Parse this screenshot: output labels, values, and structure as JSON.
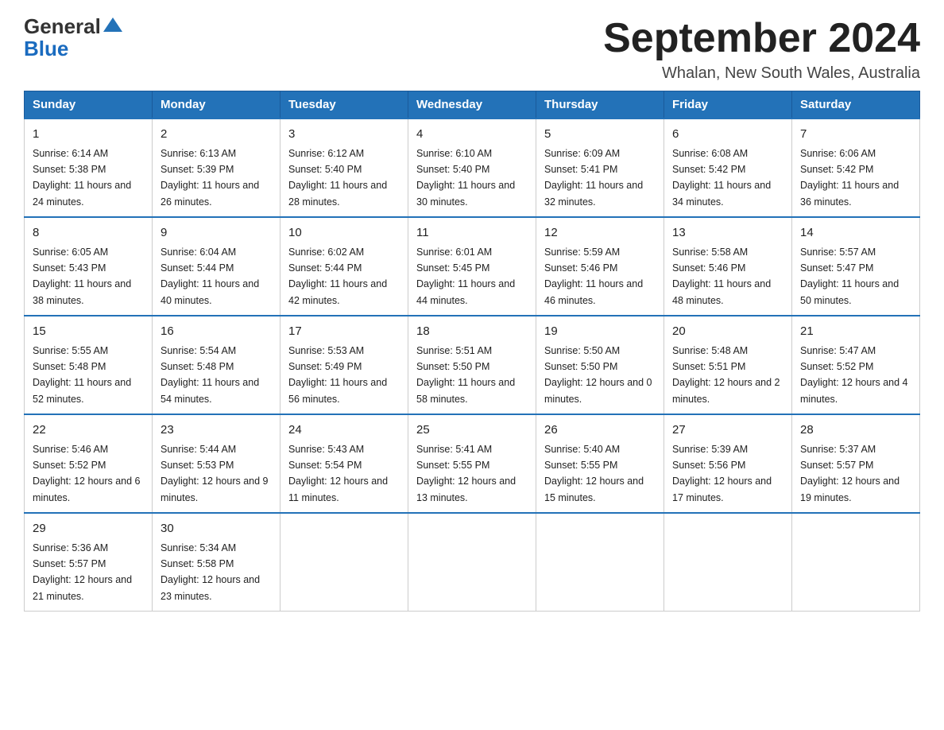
{
  "header": {
    "logo_line1": "General",
    "logo_line2": "Blue",
    "month_title": "September 2024",
    "location": "Whalan, New South Wales, Australia"
  },
  "weekdays": [
    "Sunday",
    "Monday",
    "Tuesday",
    "Wednesday",
    "Thursday",
    "Friday",
    "Saturday"
  ],
  "weeks": [
    [
      {
        "day": "1",
        "sunrise": "6:14 AM",
        "sunset": "5:38 PM",
        "daylight": "11 hours and 24 minutes."
      },
      {
        "day": "2",
        "sunrise": "6:13 AM",
        "sunset": "5:39 PM",
        "daylight": "11 hours and 26 minutes."
      },
      {
        "day": "3",
        "sunrise": "6:12 AM",
        "sunset": "5:40 PM",
        "daylight": "11 hours and 28 minutes."
      },
      {
        "day": "4",
        "sunrise": "6:10 AM",
        "sunset": "5:40 PM",
        "daylight": "11 hours and 30 minutes."
      },
      {
        "day": "5",
        "sunrise": "6:09 AM",
        "sunset": "5:41 PM",
        "daylight": "11 hours and 32 minutes."
      },
      {
        "day": "6",
        "sunrise": "6:08 AM",
        "sunset": "5:42 PM",
        "daylight": "11 hours and 34 minutes."
      },
      {
        "day": "7",
        "sunrise": "6:06 AM",
        "sunset": "5:42 PM",
        "daylight": "11 hours and 36 minutes."
      }
    ],
    [
      {
        "day": "8",
        "sunrise": "6:05 AM",
        "sunset": "5:43 PM",
        "daylight": "11 hours and 38 minutes."
      },
      {
        "day": "9",
        "sunrise": "6:04 AM",
        "sunset": "5:44 PM",
        "daylight": "11 hours and 40 minutes."
      },
      {
        "day": "10",
        "sunrise": "6:02 AM",
        "sunset": "5:44 PM",
        "daylight": "11 hours and 42 minutes."
      },
      {
        "day": "11",
        "sunrise": "6:01 AM",
        "sunset": "5:45 PM",
        "daylight": "11 hours and 44 minutes."
      },
      {
        "day": "12",
        "sunrise": "5:59 AM",
        "sunset": "5:46 PM",
        "daylight": "11 hours and 46 minutes."
      },
      {
        "day": "13",
        "sunrise": "5:58 AM",
        "sunset": "5:46 PM",
        "daylight": "11 hours and 48 minutes."
      },
      {
        "day": "14",
        "sunrise": "5:57 AM",
        "sunset": "5:47 PM",
        "daylight": "11 hours and 50 minutes."
      }
    ],
    [
      {
        "day": "15",
        "sunrise": "5:55 AM",
        "sunset": "5:48 PM",
        "daylight": "11 hours and 52 minutes."
      },
      {
        "day": "16",
        "sunrise": "5:54 AM",
        "sunset": "5:48 PM",
        "daylight": "11 hours and 54 minutes."
      },
      {
        "day": "17",
        "sunrise": "5:53 AM",
        "sunset": "5:49 PM",
        "daylight": "11 hours and 56 minutes."
      },
      {
        "day": "18",
        "sunrise": "5:51 AM",
        "sunset": "5:50 PM",
        "daylight": "11 hours and 58 minutes."
      },
      {
        "day": "19",
        "sunrise": "5:50 AM",
        "sunset": "5:50 PM",
        "daylight": "12 hours and 0 minutes."
      },
      {
        "day": "20",
        "sunrise": "5:48 AM",
        "sunset": "5:51 PM",
        "daylight": "12 hours and 2 minutes."
      },
      {
        "day": "21",
        "sunrise": "5:47 AM",
        "sunset": "5:52 PM",
        "daylight": "12 hours and 4 minutes."
      }
    ],
    [
      {
        "day": "22",
        "sunrise": "5:46 AM",
        "sunset": "5:52 PM",
        "daylight": "12 hours and 6 minutes."
      },
      {
        "day": "23",
        "sunrise": "5:44 AM",
        "sunset": "5:53 PM",
        "daylight": "12 hours and 9 minutes."
      },
      {
        "day": "24",
        "sunrise": "5:43 AM",
        "sunset": "5:54 PM",
        "daylight": "12 hours and 11 minutes."
      },
      {
        "day": "25",
        "sunrise": "5:41 AM",
        "sunset": "5:55 PM",
        "daylight": "12 hours and 13 minutes."
      },
      {
        "day": "26",
        "sunrise": "5:40 AM",
        "sunset": "5:55 PM",
        "daylight": "12 hours and 15 minutes."
      },
      {
        "day": "27",
        "sunrise": "5:39 AM",
        "sunset": "5:56 PM",
        "daylight": "12 hours and 17 minutes."
      },
      {
        "day": "28",
        "sunrise": "5:37 AM",
        "sunset": "5:57 PM",
        "daylight": "12 hours and 19 minutes."
      }
    ],
    [
      {
        "day": "29",
        "sunrise": "5:36 AM",
        "sunset": "5:57 PM",
        "daylight": "12 hours and 21 minutes."
      },
      {
        "day": "30",
        "sunrise": "5:34 AM",
        "sunset": "5:58 PM",
        "daylight": "12 hours and 23 minutes."
      },
      null,
      null,
      null,
      null,
      null
    ]
  ],
  "labels": {
    "sunrise": "Sunrise:",
    "sunset": "Sunset:",
    "daylight": "Daylight:"
  }
}
